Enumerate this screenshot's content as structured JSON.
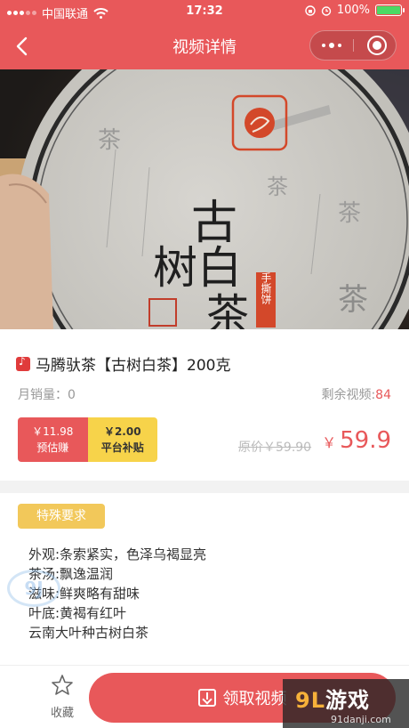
{
  "status": {
    "carrier": "中国联通",
    "time": "17:32",
    "battery": "100%"
  },
  "nav": {
    "title": "视频详情"
  },
  "hero": {
    "seal_text": "手撕饼",
    "cake_title_1": "古",
    "cake_title_2": "树白",
    "cake_title_3": "茶",
    "pattern_char": "茶"
  },
  "product": {
    "title": "马腾驮茶【古树白茶】200克",
    "monthly_sales": "月销量：0",
    "remaining_label": "剩余视频:",
    "remaining_count": "84",
    "earn_value": "￥11.98",
    "earn_label": "预估赚",
    "subsidy_value": "￥2.00",
    "subsidy_label": "平台补贴",
    "original_price": "原价￥59.90",
    "price_symbol": "￥",
    "price": "59.9"
  },
  "requirements": {
    "tag": "特殊要求",
    "lines": [
      "外观:条索紧实，色泽乌褐显亮",
      "茶汤:飘逸温润",
      "滋味:鲜爽略有甜味",
      "叶底:黄褐有红叶",
      "云南大叶种古树白茶"
    ]
  },
  "bottom": {
    "favorite_label": "收藏",
    "claim_label": "领取视频"
  },
  "watermark": {
    "left": "9J",
    "logo_num": "9L",
    "logo_text": "游戏",
    "url": "91danji.com"
  },
  "colors": {
    "brand_red": "#e8585a",
    "subsidy_yellow": "#f7d34a",
    "tag_yellow": "#f2c85a"
  }
}
